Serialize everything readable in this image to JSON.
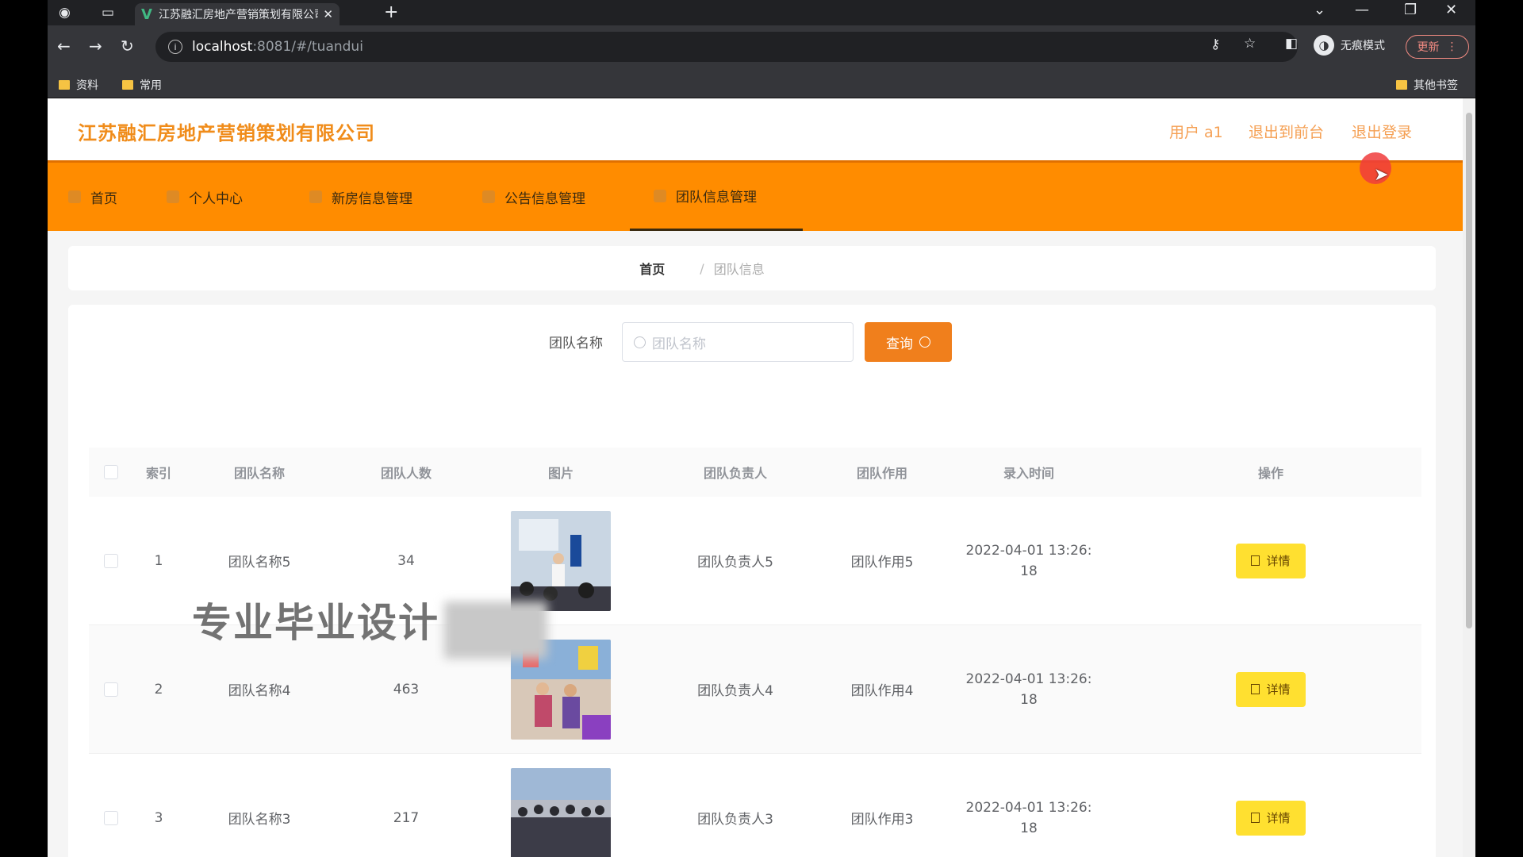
{
  "browser": {
    "tab_title": "江苏融汇房地产营销策划有限公司",
    "url_host": "localhost",
    "url_path": ":8081/#/tuandui",
    "incognito_label": "无痕模式",
    "update_label": "更新",
    "bookmarks": [
      "资料",
      "常用"
    ],
    "other_bookmarks": "其他书签"
  },
  "header": {
    "brand": "江苏融汇房地产营销策划有限公司",
    "user": "用户 a1",
    "back_front": "退出到前台",
    "logout": "退出登录"
  },
  "menu": [
    "首页",
    "个人中心",
    "新房信息管理",
    "公告信息管理",
    "团队信息管理"
  ],
  "breadcrumb": {
    "home": "首页",
    "sep": "/",
    "current": "团队信息"
  },
  "search": {
    "label": "团队名称",
    "placeholder": "团队名称",
    "button": "查询"
  },
  "table": {
    "headers": [
      "索引",
      "团队名称",
      "团队人数",
      "图片",
      "团队负责人",
      "团队作用",
      "录入时间",
      "操作"
    ],
    "rows": [
      {
        "index": "1",
        "name": "团队名称5",
        "count": "34",
        "leader": "团队负责人5",
        "role": "团队作用5",
        "time1": "2022-04-01 13:26:",
        "time2": "18",
        "action": "详情"
      },
      {
        "index": "2",
        "name": "团队名称4",
        "count": "463",
        "leader": "团队负责人4",
        "role": "团队作用4",
        "time1": "2022-04-01 13:26:",
        "time2": "18",
        "action": "详情"
      },
      {
        "index": "3",
        "name": "团队名称3",
        "count": "217",
        "leader": "团队负责人3",
        "role": "团队作用3",
        "time1": "2022-04-01 13:26:",
        "time2": "18",
        "action": "详情"
      }
    ]
  },
  "watermark": "专业毕业设计",
  "colors": {
    "accent": "#ff8c00",
    "brand": "#f08c1a",
    "detail_button": "#ffe030"
  }
}
